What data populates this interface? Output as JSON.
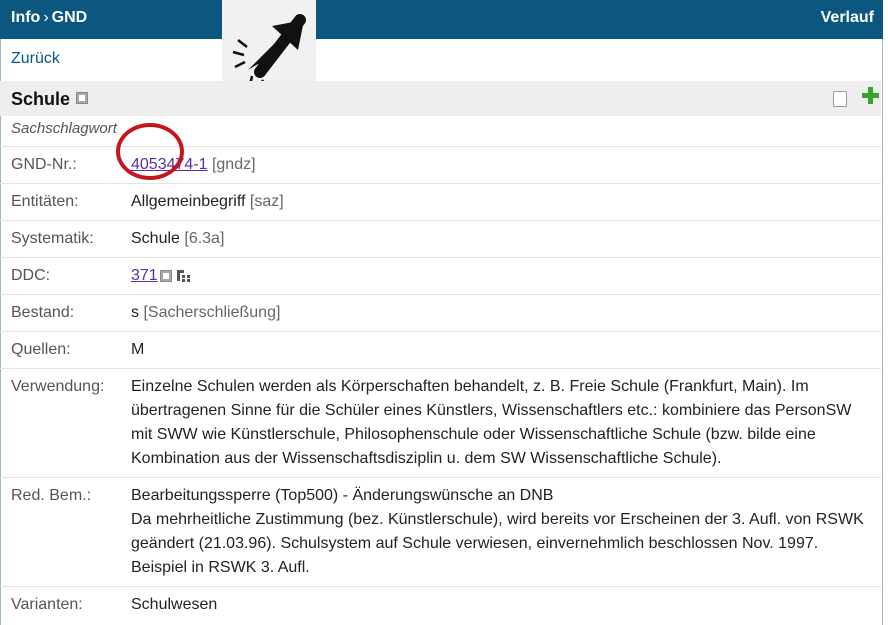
{
  "topbar": {
    "crumb1": "Info",
    "sep": "›",
    "crumb2": "GND",
    "history": "Verlauf"
  },
  "nav": {
    "back": "Zurück"
  },
  "record": {
    "title": "Schule",
    "subtype": "Sachschlagwort"
  },
  "fields": {
    "gnd_label": "GND-Nr.:",
    "gnd_value": "4053474-1",
    "gnd_suffix": " [gndz]",
    "ent_label": "Entitäten:",
    "ent_value": "Allgemeinbegriff",
    "ent_suffix": " [saz]",
    "sys_label": "Systematik:",
    "sys_value": "Schule",
    "sys_suffix": " [6.3a]",
    "ddc_label": "DDC:",
    "ddc_value": "371",
    "best_label": "Bestand:",
    "best_value": "s",
    "best_suffix": " [Sacherschließung]",
    "quel_label": "Quellen:",
    "quel_value": "M",
    "verw_label": "Verwendung:",
    "verw_value": "Einzelne Schulen werden als Körperschaften behandelt, z. B. Freie Schule (Frankfurt, Main). Im übertragenen Sinne für die Schüler eines Künstlers, Wissenschaftlers etc.: kombiniere das PersonSW mit SWW wie Künstlerschule, Philosophenschule oder Wissenschaftliche Schule (bzw. bilde eine Kombination aus der Wissenschaftsdisziplin u. dem SW Wissenschaftliche Schule).",
    "red_label": "Red. Bem.:",
    "red_line1": "Bearbeitungssperre (Top500) - Änderungswünsche an DNB",
    "red_line2": "Da mehrheitliche Zustimmung (bez. Künstlerschule), wird bereits vor Erscheinen der 3. Aufl. von RSWK geändert (21.03.96). Schulsystem auf Schule verwiesen, einvernehmlich beschlossen Nov. 1997. Beispiel in RSWK 3. Aufl.",
    "var_label": "Varianten:",
    "var_value": "Schulwesen"
  },
  "icons": {
    "info_square": "square-info-icon",
    "copy": "copy-icon",
    "add": "plus-icon",
    "hierarchy": "hierarchy-icon",
    "cursor": "click-cursor-icon"
  },
  "colors": {
    "bar": "#0c5780",
    "link": "#5a2ea6",
    "annotation": "#c4161c",
    "add": "#37a32f"
  }
}
